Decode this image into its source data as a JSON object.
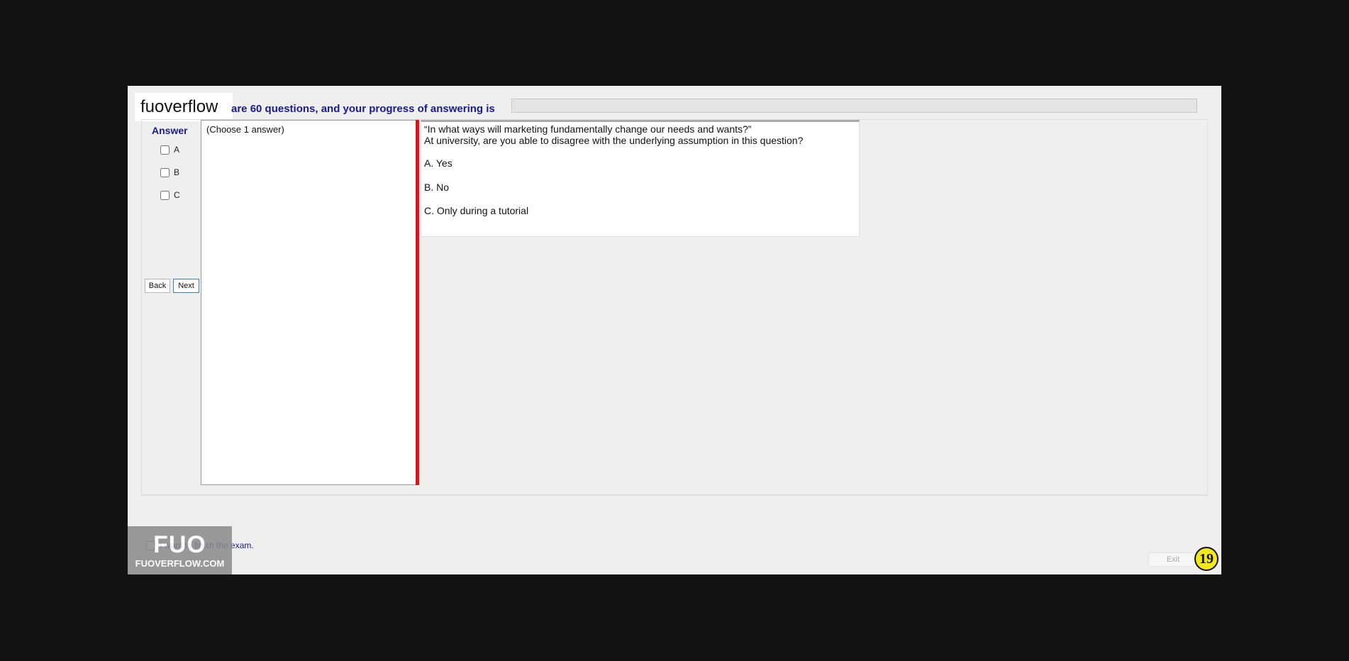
{
  "branding": {
    "logo_text": "fuoverflow",
    "watermark_big": "FUO",
    "watermark_small": "FUOVERFLOW.COM"
  },
  "header": {
    "progress_text": "are 60 questions, and your progress of answering is",
    "progress_value": 0
  },
  "answer_panel": {
    "title": "Answer",
    "options": [
      {
        "label": "A",
        "checked": false
      },
      {
        "label": "B",
        "checked": false
      },
      {
        "label": "C",
        "checked": false
      }
    ]
  },
  "nav": {
    "back_label": "Back",
    "next_label": "Next"
  },
  "choose_panel": {
    "instruction": "(Choose 1 answer)"
  },
  "question": {
    "line1": "“In what ways will marketing fundamentally change our needs and wants?”",
    "line2": "At university, are you able to disagree with the underlying assumption in this question?",
    "options": [
      "A.  Yes",
      "B.  No",
      "C.  Only during a tutorial"
    ]
  },
  "footer": {
    "finish_label": "I want to finish the exam.",
    "exit_label": "Exit",
    "page_number": "19"
  },
  "colors": {
    "accent_text": "#1a1a8c",
    "splitter": "#d81818",
    "page_badge": "#f2e81c"
  }
}
